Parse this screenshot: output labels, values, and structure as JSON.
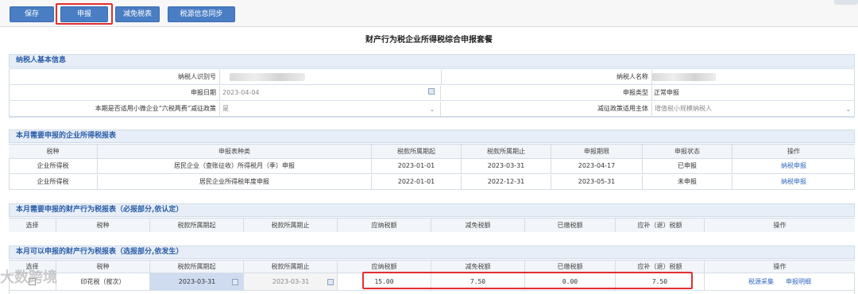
{
  "toolbar": {
    "buttons": [
      {
        "label": "保存"
      },
      {
        "label": "申报"
      },
      {
        "label": "减免税表"
      },
      {
        "label": "税源信息同步"
      }
    ]
  },
  "page_title": "财产行为税企业所得税综合申报套餐",
  "taxpayer_section": {
    "header": "纳税人基本信息",
    "taxpayer_id_label": "纳税人识别号",
    "taxpayer_name_label": "纳税人名称",
    "declare_date_label": "申报日期",
    "declare_date_value": "2023-04-04",
    "declare_type_label": "申报类型",
    "declare_type_value": "正常申报",
    "six_tax_label": "本期是否适用小微企业“六税两费”减征政策",
    "six_tax_value": "是",
    "subject_label": "减征政策适用主体",
    "subject_value": "增值税小规模纳税人"
  },
  "income_tax_section": {
    "header": "本月需要申报的企业所得税报表",
    "columns": [
      "税种",
      "申报表种类",
      "税款所属期起",
      "税款所属期止",
      "申报期限",
      "申报状态",
      "操作"
    ],
    "rows": [
      {
        "tax": "企业所得税",
        "form": "居民企业（查账征收）所得税月（季）申报",
        "start": "2023-01-01",
        "end": "2023-03-31",
        "deadline": "2023-04-17",
        "status": "已申报",
        "action": "纳税申报"
      },
      {
        "tax": "企业所得税",
        "form": "居民企业所得税年度申报",
        "start": "2022-01-01",
        "end": "2022-12-31",
        "deadline": "2023-05-31",
        "status": "未申报",
        "action": "纳税申报"
      }
    ]
  },
  "required_section": {
    "header": "本月需要申报的财产行为税报表（必报部分,依认定）",
    "columns": [
      "选择",
      "税种",
      "税款所属期起",
      "税款所属期止",
      "应纳税额",
      "减免税额",
      "已缴税额",
      "应补（退）税额",
      "操作"
    ]
  },
  "optional_section": {
    "header": "本月可以申报的财产行为税报表（选报部分,依发生）",
    "columns": [
      "选择",
      "税种",
      "税款所属期起",
      "税款所属期止",
      "应纳税额",
      "减免税额",
      "已缴税额",
      "应补（退）税额",
      "操作"
    ],
    "row": {
      "tax": "印花税（按次）",
      "start": "2023-03-31",
      "end": "2023-03-31",
      "payable": "15.00",
      "reduced": "7.50",
      "paid": "0.00",
      "due": "7.50",
      "action1": "税源采集",
      "action2": "申报明细"
    }
  },
  "watermark": "大数跨境",
  "colors": {
    "accent": "#4a7ec4",
    "highlight": "#e12f2f",
    "link": "#2e68c0",
    "section_header_bg": "#e7eef7"
  }
}
